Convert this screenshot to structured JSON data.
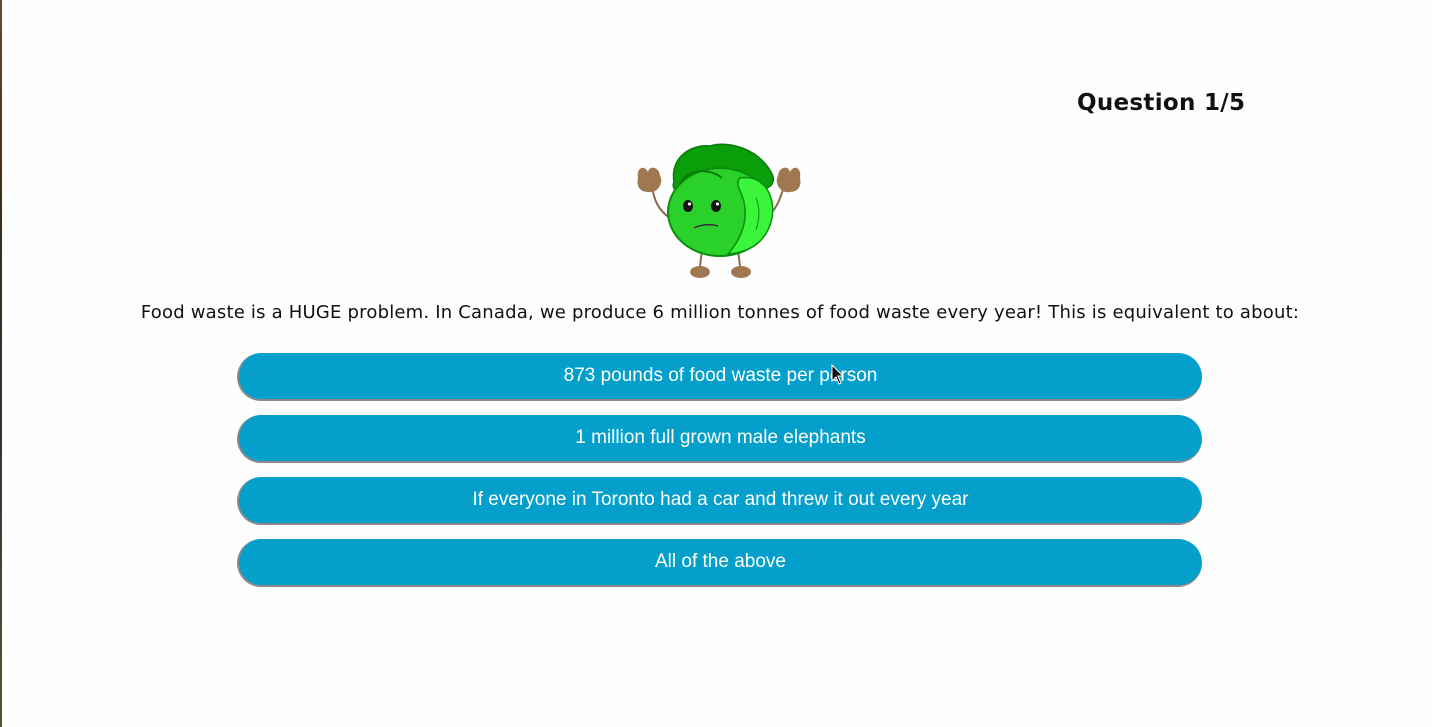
{
  "quiz": {
    "counter": "Question 1/5",
    "question": "Food waste is a HUGE problem. In Canada, we produce 6 million tonnes of food waste every year! This is equivalent to about:",
    "answers": [
      "873 pounds of food waste per person",
      "1 million full grown male elephants",
      "If everyone in Toronto had a car and threw it out every year",
      "All of the above"
    ]
  },
  "mascot": {
    "icon": "lettuce-character-icon"
  },
  "colors": {
    "answer_background": "#049fca",
    "answer_text": "#ffffff",
    "page_background": "#fefefe"
  }
}
